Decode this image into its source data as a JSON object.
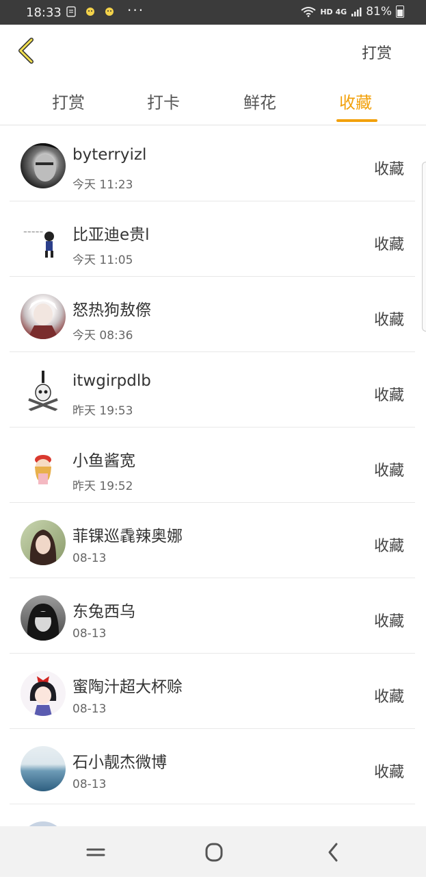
{
  "status_bar": {
    "time": "18:33",
    "network": "HD 4G",
    "battery": "81%"
  },
  "header": {
    "right_action": "打赏"
  },
  "tabs": [
    {
      "label": "打赏"
    },
    {
      "label": "打卡"
    },
    {
      "label": "鲜花"
    },
    {
      "label": "收藏"
    }
  ],
  "active_tab": "收藏",
  "accent_color": "#f2a10c",
  "list": [
    {
      "name": "byterryizl",
      "time": "今天 11:23",
      "action": "收藏",
      "avatar": "bw-face-photo"
    },
    {
      "name": "比亚迪e贵l",
      "time": "今天 11:05",
      "action": "收藏",
      "avatar": "cartoon-boy"
    },
    {
      "name": "怒热狗敖傺",
      "time": "今天 08:36",
      "action": "收藏",
      "avatar": "anime-white-hair"
    },
    {
      "name": "itwgirpdlb",
      "time": "昨天 19:53",
      "action": "收藏",
      "avatar": "skull-crossbones"
    },
    {
      "name": "小鱼酱宽",
      "time": "昨天 19:52",
      "action": "收藏",
      "avatar": "cartoon-girl"
    },
    {
      "name": "菲锞巡毳辣奥娜",
      "time": "08-13",
      "action": "收藏",
      "avatar": "girl-photo"
    },
    {
      "name": "东兔西乌",
      "time": "08-13",
      "action": "收藏",
      "avatar": "bw-girl-photo"
    },
    {
      "name": "蜜陶汁超大杯赊",
      "time": "08-13",
      "action": "收藏",
      "avatar": "snow-white-doll"
    },
    {
      "name": "石小靓杰微博",
      "time": "08-13",
      "action": "收藏",
      "avatar": "ocean-photo"
    }
  ]
}
